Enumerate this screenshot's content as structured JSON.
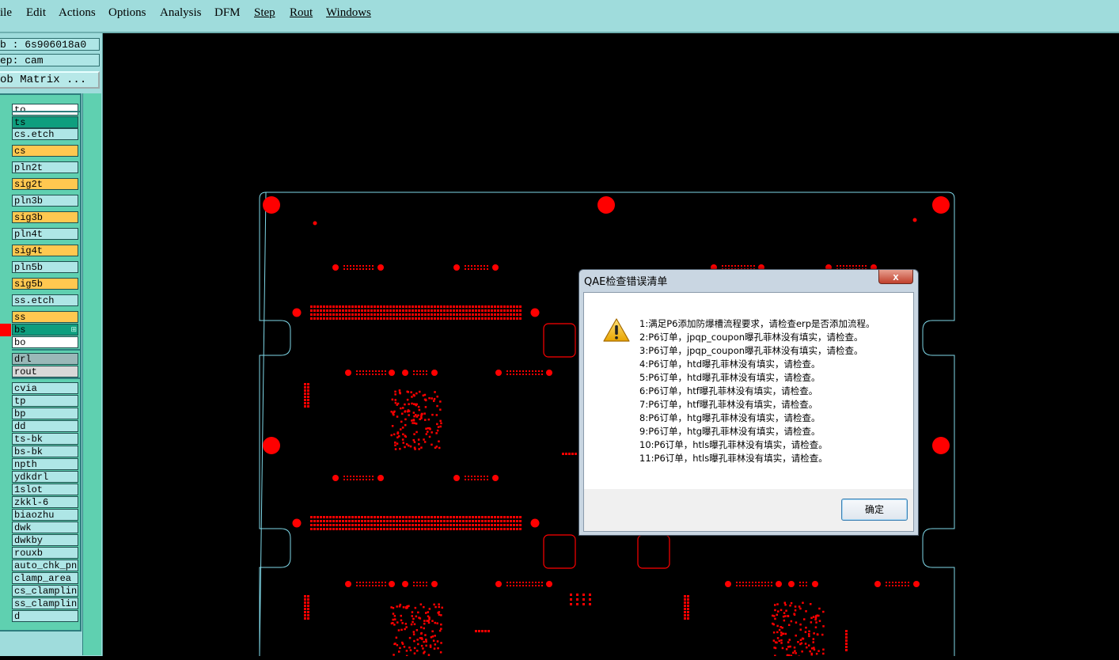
{
  "menubar": {
    "items": [
      "ile",
      "Edit",
      "Actions",
      "Options",
      "Analysis",
      "DFM",
      "Step",
      "Rout",
      "Windows"
    ]
  },
  "panel": {
    "job_line": "b : 6s906018a0",
    "step_line": "ep: cam",
    "matrix_button": "ob Matrix ..."
  },
  "layers": [
    {
      "name": "to",
      "color": "#ffffff"
    },
    {
      "name": "ts",
      "color": "#0e9e7e"
    },
    {
      "name": "cs.etch",
      "color": "#aee6e6"
    },
    {
      "name": "cs",
      "color": "#ffc850"
    },
    {
      "name": "pln2t",
      "color": "#aee6e6"
    },
    {
      "name": "sig2t",
      "color": "#ffc850"
    },
    {
      "name": "pln3b",
      "color": "#aee6e6"
    },
    {
      "name": "sig3b",
      "color": "#ffc850"
    },
    {
      "name": "pln4t",
      "color": "#aee6e6"
    },
    {
      "name": "sig4t",
      "color": "#ffc850"
    },
    {
      "name": "pln5b",
      "color": "#aee6e6"
    },
    {
      "name": "sig5b",
      "color": "#ffc850"
    },
    {
      "name": "ss.etch",
      "color": "#aee6e6"
    },
    {
      "name": "ss",
      "color": "#ffc850"
    },
    {
      "name": "bs",
      "color": "#0e9e7e",
      "active": true
    },
    {
      "name": "bo",
      "color": "#ffffff"
    },
    {
      "name": "drl",
      "color": "#9ab8b8"
    },
    {
      "name": "rout",
      "color": "#d8d8d8"
    },
    {
      "name": "cvia",
      "color": "#aee6e6"
    },
    {
      "name": "tp",
      "color": "#aee6e6"
    },
    {
      "name": "bp",
      "color": "#aee6e6"
    },
    {
      "name": "dd",
      "color": "#aee6e6"
    },
    {
      "name": "ts-bk",
      "color": "#aee6e6"
    },
    {
      "name": "bs-bk",
      "color": "#aee6e6"
    },
    {
      "name": "npth",
      "color": "#aee6e6"
    },
    {
      "name": "ydkdrl",
      "color": "#aee6e6"
    },
    {
      "name": "1slot",
      "color": "#aee6e6"
    },
    {
      "name": "zkkl-6",
      "color": "#aee6e6"
    },
    {
      "name": "biaozhu",
      "color": "#aee6e6"
    },
    {
      "name": "dwk",
      "color": "#aee6e6"
    },
    {
      "name": "dwkby",
      "color": "#aee6e6"
    },
    {
      "name": "rouxb",
      "color": "#aee6e6"
    },
    {
      "name": "auto_chk_pnl",
      "color": "#aee6e6"
    },
    {
      "name": "clamp_area",
      "color": "#aee6e6"
    },
    {
      "name": "cs_clampline",
      "color": "#aee6e6"
    },
    {
      "name": "ss_clampline",
      "color": "#aee6e6"
    },
    {
      "name": "d",
      "color": "#aee6e6"
    }
  ],
  "colors": {
    "board_outline": "#7fd8e8",
    "pad_red": "#ff0000",
    "active_indicator": "#ff0000"
  },
  "dialog": {
    "title": "QAE检查错误清单",
    "close_label": "x",
    "icon": "warning-icon",
    "messages": [
      "1:满足P6添加防爆槽流程要求，请检查erp是否添加流程。",
      "2:P6订单，jpqp_coupon曝孔菲林没有填实，请检查。",
      "3:P6订单，jpqp_coupon曝孔菲林没有填实，请检查。",
      "4:P6订单，htd曝孔菲林没有填实，请检查。",
      "5:P6订单，htd曝孔菲林没有填实，请检查。",
      "6:P6订单，htf曝孔菲林没有填实，请检查。",
      "7:P6订单，htf曝孔菲林没有填实，请检查。",
      "8:P6订单，htg曝孔菲林没有填实，请检查。",
      "9:P6订单，htg曝孔菲林没有填实，请检查。",
      "10:P6订单，htls曝孔菲林没有填实，请检查。",
      "11:P6订单，htls曝孔菲林没有填实，请检查。"
    ],
    "ok_label": "确定"
  }
}
